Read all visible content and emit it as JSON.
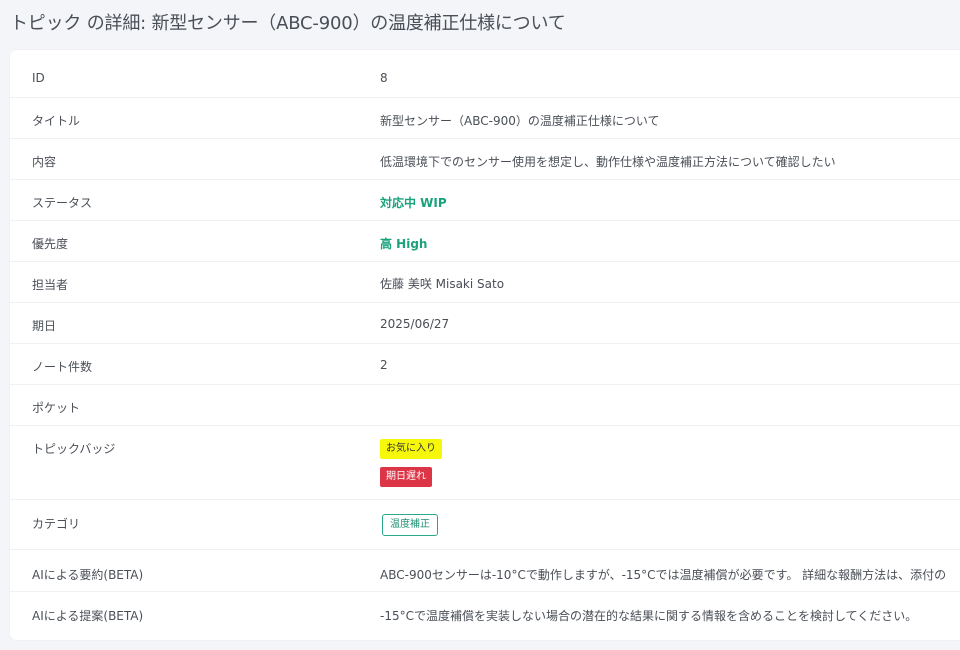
{
  "page": {
    "title": "トピック の詳細: 新型センサー（ABC-900）の温度補正仕様について"
  },
  "details": {
    "id_label": "ID",
    "id_value": "8",
    "title_label": "タイトル",
    "title_value": "新型センサー（ABC-900）の温度補正仕様について",
    "content_label": "内容",
    "content_value": "低温環境下でのセンサー使用を想定し、動作仕様や温度補正方法について確認したい",
    "status_label": "ステータス",
    "status_value": "対応中 WIP",
    "priority_label": "優先度",
    "priority_value": "高 High",
    "assignee_label": "担当者",
    "assignee_value": "佐藤 美咲 Misaki Sato",
    "due_label": "期日",
    "due_value": "2025/06/27",
    "notes_label": "ノート件数",
    "notes_value": "2",
    "pocket_label": "ポケット",
    "pocket_value": "",
    "badges_label": "トピックバッジ",
    "badges": [
      "お気に入り",
      "期日遅れ"
    ],
    "category_label": "カテゴリ",
    "category_value": "温度補正",
    "ai_summary_label": "AIによる要約(BETA)",
    "ai_summary_value": "ABC-900センサーは-10°Cで動作しますが、-15°Cでは温度補償が必要です。 詳細な報酬方法は、添付の",
    "ai_suggestion_label": "AIによる提案(BETA)",
    "ai_suggestion_value": "-15°Cで温度補償を実装しない場合の潜在的な結果に関する情報を含めることを検討してください。"
  },
  "colors": {
    "accent_green": "#1aa27c",
    "favorite_badge": "#f7f70b",
    "overdue_badge": "#dc3545",
    "category_border": "#2aa88a"
  }
}
